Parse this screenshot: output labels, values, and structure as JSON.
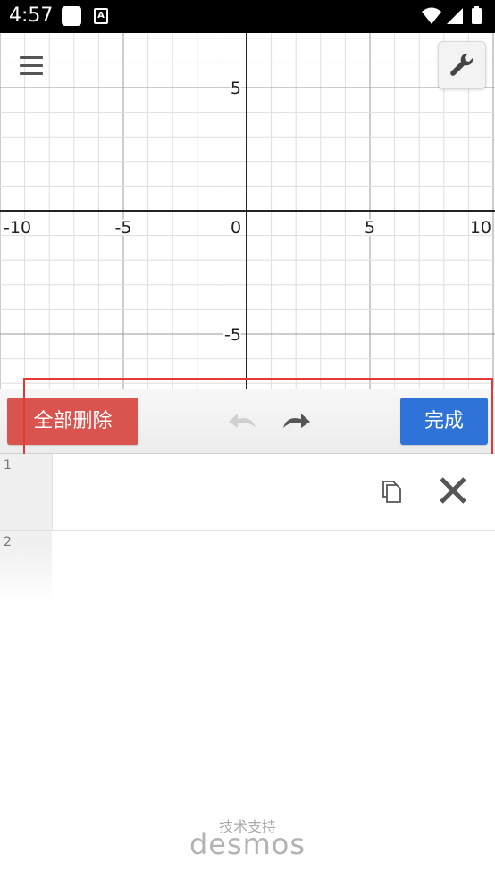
{
  "status_bar": {
    "time": "4:57",
    "icons": [
      "notification-square-icon",
      "a-badge-icon",
      "wifi-icon",
      "signal-icon",
      "battery-icon"
    ]
  },
  "graph": {
    "x_ticks": [
      "-10",
      "-5",
      "0",
      "5",
      "10"
    ],
    "y_ticks": [
      "5",
      "-5"
    ],
    "x_range": [
      -10,
      10
    ],
    "y_range": [
      -7,
      7
    ]
  },
  "toolbar": {
    "delete_all_label": "全部删除",
    "done_label": "完成",
    "undo_icon": "undo-icon",
    "redo_icon": "redo-icon"
  },
  "expressions": [
    {
      "index": "1",
      "value": ""
    },
    {
      "index": "2",
      "value": ""
    }
  ],
  "footer": {
    "powered_by": "技术支持",
    "brand": "desmos"
  },
  "colors": {
    "delete_red": "#d9534f",
    "done_blue": "#2f72d8",
    "highlight_red": "#e53935"
  }
}
